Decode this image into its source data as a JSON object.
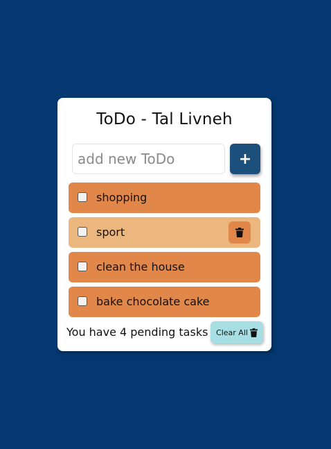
{
  "app": {
    "title": "ToDo - Tal Livneh"
  },
  "new_todo": {
    "placeholder": "add new ToDo",
    "value": "",
    "add_label": "+"
  },
  "tasks": [
    {
      "label": "shopping",
      "checked": false
    },
    {
      "label": "sport",
      "checked": false
    },
    {
      "label": "clean the house",
      "checked": false
    },
    {
      "label": "bake chocolate cake",
      "checked": false
    }
  ],
  "footer": {
    "pending_text": "You have 4 pending tasks",
    "clear_label": "Clear All"
  },
  "colors": {
    "background": "#053870",
    "task": "#e2874a",
    "task_hover": "#ecb77e",
    "add_button": "#1d4f7c",
    "clear_button": "#a6dee4"
  },
  "icons": {
    "add": "plus-icon",
    "delete": "trash-icon",
    "clear": "trash-icon"
  }
}
